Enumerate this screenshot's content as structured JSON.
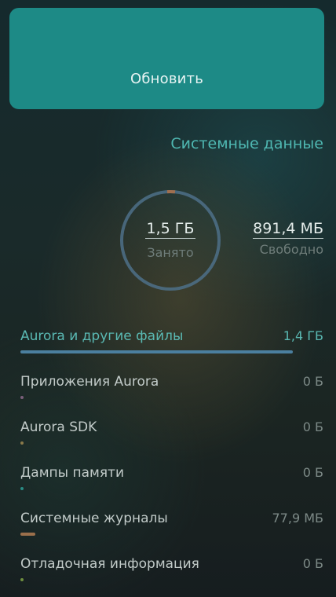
{
  "update_button": {
    "label": "Обновить"
  },
  "section": {
    "title": "Системные данные"
  },
  "summary": {
    "used_value": "1,5 ГБ",
    "used_label": "Занято",
    "free_value": "891,4 МБ",
    "free_label": "Свободно"
  },
  "categories": [
    {
      "name": "Aurora и другие файлы",
      "size": "1,4 ГБ",
      "bar_color": "#4b7f9f",
      "bar_fraction": 0.9
    },
    {
      "name": "Приложения Aurora",
      "size": "0 Б",
      "bar_color": "#7a5f7b",
      "bar_fraction": 0.01
    },
    {
      "name": "Aurora SDK",
      "size": "0 Б",
      "bar_color": "#8b7a4a",
      "bar_fraction": 0.01
    },
    {
      "name": "Дампы памяти",
      "size": "0 Б",
      "bar_color": "#2a8c84",
      "bar_fraction": 0.01
    },
    {
      "name": "Системные журналы",
      "size": "77,9 МБ",
      "bar_color": "#9b6f4b",
      "bar_fraction": 0.05
    },
    {
      "name": "Отладочная информация",
      "size": "0 Б",
      "bar_color": "#6f8f3f",
      "bar_fraction": 0.01
    }
  ]
}
